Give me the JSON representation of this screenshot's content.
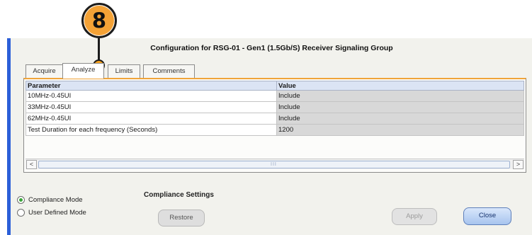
{
  "callout": {
    "number": "8"
  },
  "window": {
    "title": "Configuration for RSG-01 - Gen1 (1.5Gb/S) Receiver Signaling Group"
  },
  "tabs": [
    {
      "label": "Acquire",
      "active": false
    },
    {
      "label": "Analyze",
      "active": true
    },
    {
      "label": "Limits",
      "active": false
    },
    {
      "label": "Comments",
      "active": false
    }
  ],
  "table": {
    "headers": [
      "Parameter",
      "Value"
    ],
    "rows": [
      {
        "param": "10MHz-0.45UI",
        "value": "Include"
      },
      {
        "param": "33MHz-0.45UI",
        "value": "Include"
      },
      {
        "param": "62MHz-0.45UI",
        "value": "Include"
      },
      {
        "param": "Test Duration for each frequency (Seconds)",
        "value": "1200"
      }
    ]
  },
  "scrollbar": {
    "left_glyph": "<",
    "right_glyph": ">",
    "grip": "III"
  },
  "mode": {
    "options": [
      {
        "label": "Compliance Mode",
        "selected": true
      },
      {
        "label": "User Defined Mode",
        "selected": false
      }
    ]
  },
  "compliance_settings": {
    "label": "Compliance Settings",
    "restore_label": "Restore"
  },
  "buttons": {
    "apply_label": "Apply",
    "close_label": "Close"
  },
  "colors": {
    "accent_orange": "#f0a43a",
    "accent_blue": "#2c5fd8",
    "header_blue": "#dbe4f4",
    "value_cell_gray": "#d8d8d8"
  }
}
